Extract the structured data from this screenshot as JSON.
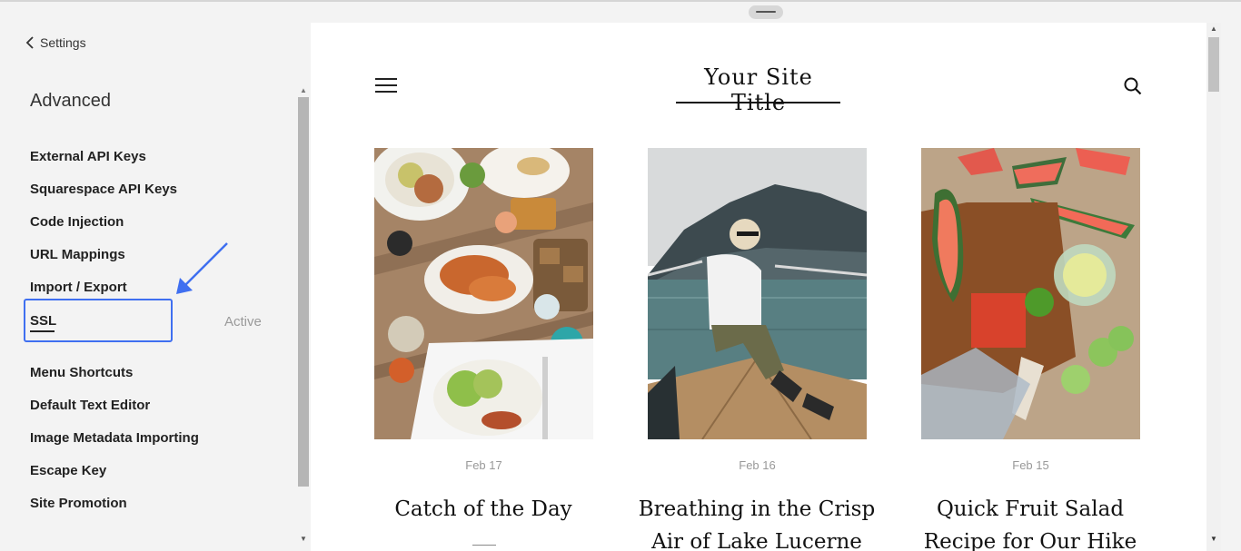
{
  "sidebar": {
    "back_label": "Settings",
    "title": "Advanced",
    "items": [
      {
        "label": "External API Keys"
      },
      {
        "label": "Squarespace API Keys"
      },
      {
        "label": "Code Injection"
      },
      {
        "label": "URL Mappings"
      },
      {
        "label": "Import / Export"
      },
      {
        "label": "SSL",
        "status": "Active"
      },
      {
        "label": "Menu Shortcuts"
      },
      {
        "label": "Default Text Editor"
      },
      {
        "label": "Image Metadata Importing"
      },
      {
        "label": "Escape Key"
      },
      {
        "label": "Site Promotion"
      }
    ],
    "highlight_color": "#3f6ff0"
  },
  "preview": {
    "site_title": "Your Site Title",
    "posts": [
      {
        "date": "Feb 17",
        "title": "Catch of the Day",
        "image": "food-table-photo"
      },
      {
        "date": "Feb 16",
        "title": "Breathing in the Crisp Air of Lake Lucerne",
        "image": "woman-on-boat-photo"
      },
      {
        "date": "Feb 15",
        "title": "Quick Fruit Salad Recipe for Our Hike",
        "image": "watermelon-board-photo"
      }
    ]
  }
}
